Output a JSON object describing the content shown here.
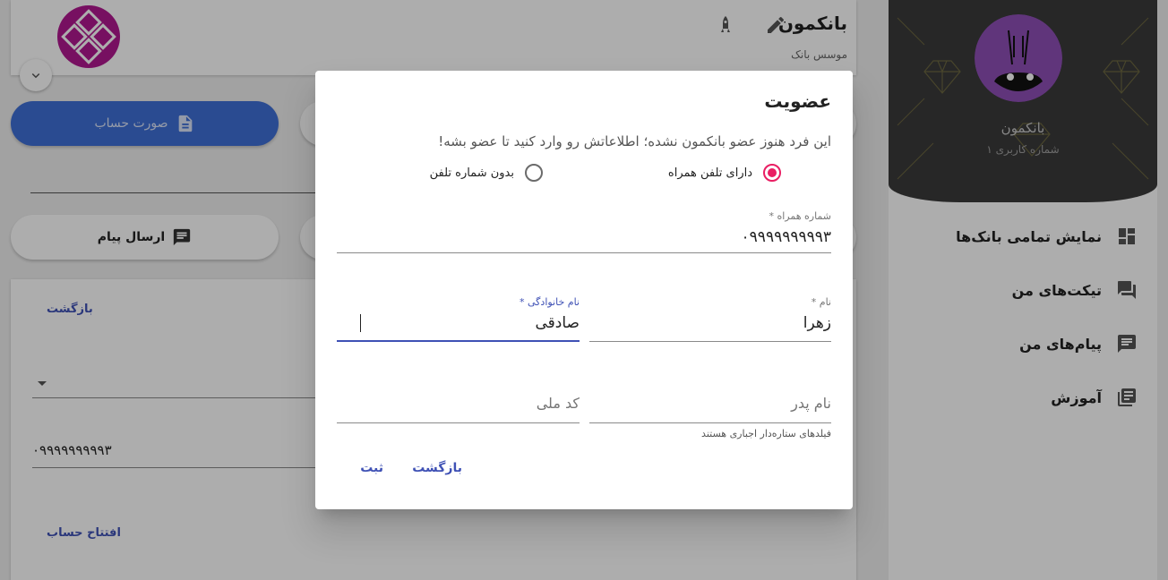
{
  "header": {
    "title": "بانکمون",
    "subtitle": "موسس بانک"
  },
  "actions": {
    "statement_label": "صورت حساب",
    "send_message_label": "ارسال پیام"
  },
  "main": {
    "back_label": "بازگشت",
    "phone_value": "۰۹۹۹۹۹۹۹۹۹۳",
    "open_account_label": "افتتاح حساب"
  },
  "sidebar": {
    "name": "بانکمون",
    "user_number": "شماره کاربری ۱",
    "items": [
      {
        "label": "نمایش تمامی بانک‌ها",
        "icon": "dashboard-icon"
      },
      {
        "label": "تیکت‌های من",
        "icon": "forum-icon"
      },
      {
        "label": "پیام‌های من",
        "icon": "message-icon"
      },
      {
        "label": "آموزش",
        "icon": "library-books-icon"
      }
    ]
  },
  "dialog": {
    "title": "عضویت",
    "description": "این فرد هنوز عضو بانکمون نشده؛ اطلاعاتش رو وارد کنید تا عضو بشه!",
    "radio_with_phone": "دارای تلفن همراه",
    "radio_without_phone": "بدون شماره تلفن",
    "selected_option": "radio_with_phone",
    "phone_label": "شماره همراه *",
    "phone_value": "۰۹۹۹۹۹۹۹۹۹۳",
    "first_name_label": "نام *",
    "first_name_value": "زهرا",
    "last_name_label": "نام خانوادگی *",
    "last_name_value": "صادقی",
    "father_name_placeholder": "نام پدر",
    "national_code_placeholder": "کد ملی",
    "required_hint": "فیلدهای ستاره‌دار اجباری هستند",
    "back_button": "بازگشت",
    "submit_button": "ثبت"
  },
  "colors": {
    "accent": "#3f51b5",
    "radio": "#e91e63",
    "statement_button": "#3f6fd6",
    "sidebar_header": "#3a3a3a"
  }
}
